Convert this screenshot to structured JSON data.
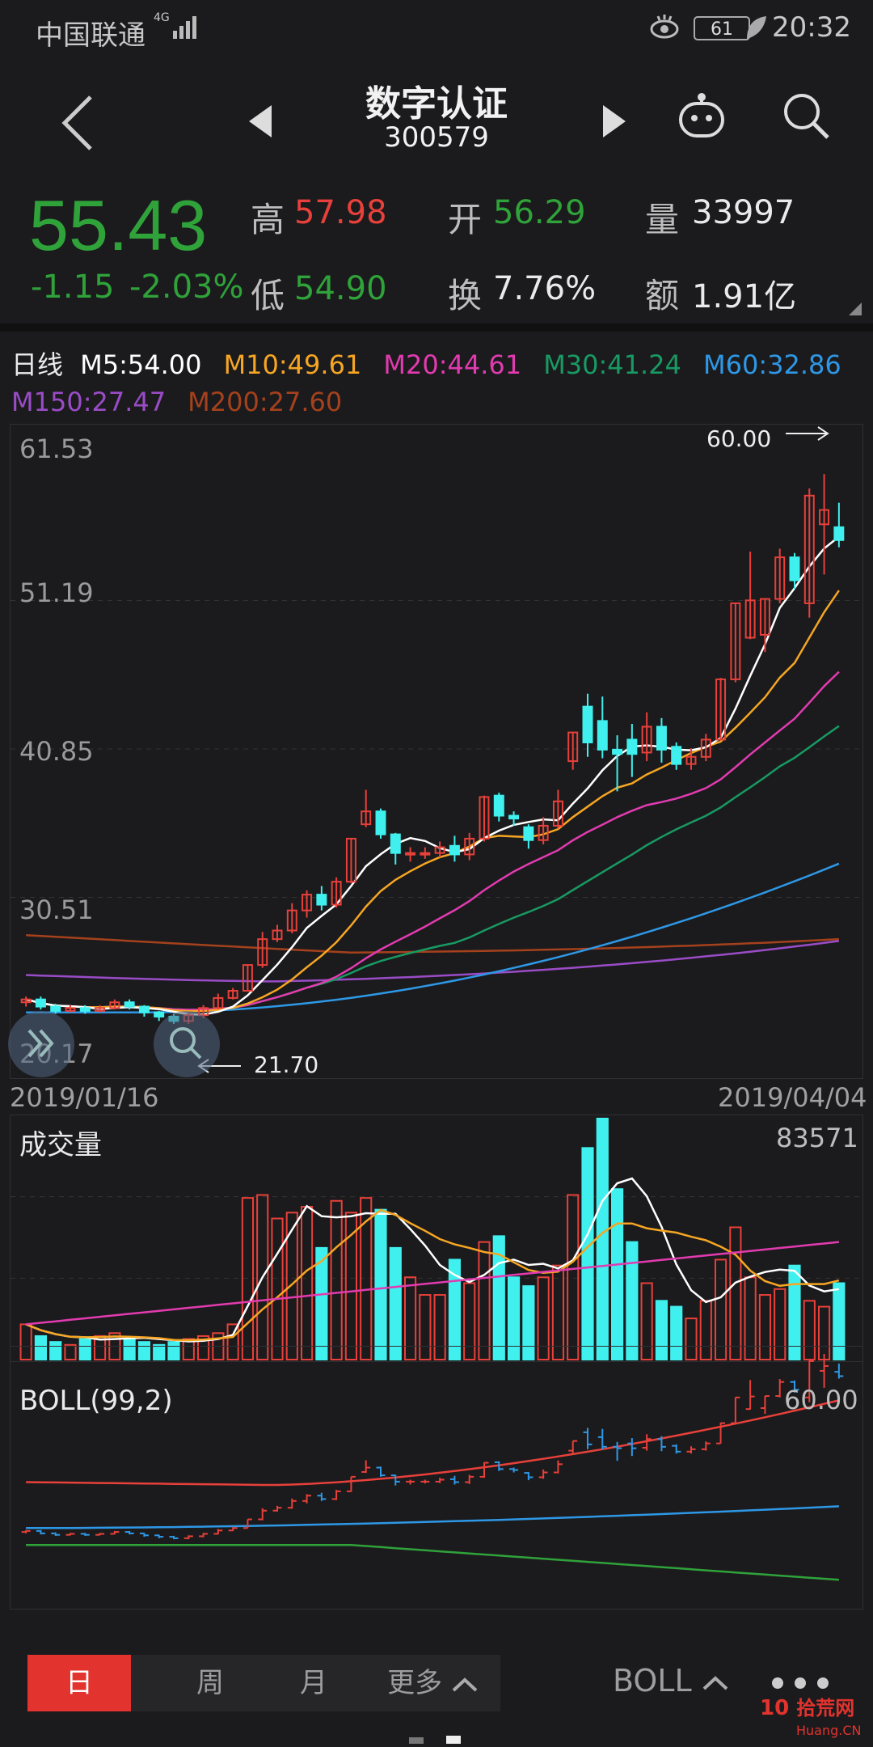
{
  "status_bar": {
    "carrier": "中国联通",
    "network": "4G",
    "battery": "61",
    "time": "20:32"
  },
  "header": {
    "name": "数字认证",
    "code": "300579"
  },
  "quote": {
    "price": "55.43",
    "change": "-1.15",
    "change_pct": "-2.03%",
    "high_label": "高",
    "high": "57.98",
    "low_label": "低",
    "low": "54.90",
    "open_label": "开",
    "open": "56.29",
    "turnover_label": "换",
    "turnover": "7.76%",
    "volume_label": "量",
    "volume": "33997",
    "amount_label": "额",
    "amount": "1.91亿"
  },
  "ma_legend": {
    "period": "日线",
    "m5": "M5:54.00",
    "m10": "M10:49.61",
    "m20": "M20:44.61",
    "m30": "M30:41.24",
    "m60": "M60:32.86",
    "m150": "M150:27.47",
    "m200": "M200:27.60"
  },
  "colors": {
    "up": "#e8403a",
    "down": "#3ff0ee",
    "m5": "#ffffff",
    "m10": "#f6a623",
    "m20": "#e23bb0",
    "m30": "#189a63",
    "m60": "#2e98e6",
    "m150": "#9a4cc7",
    "m200": "#a5411c"
  },
  "kline": {
    "y_labels": [
      "61.53",
      "51.19",
      "40.85",
      "30.51",
      "20.17"
    ],
    "high_marker": "60.00",
    "low_marker": "21.70",
    "date_start": "2019/01/16",
    "date_end": "2019/04/04",
    "ylim": [
      20.17,
      61.53
    ]
  },
  "volume_panel": {
    "title": "成交量",
    "max_label": "83571"
  },
  "boll_panel": {
    "title": "BOLL(99,2)",
    "high_marker": "60.00"
  },
  "tabs": {
    "day": "日",
    "week": "周",
    "month": "月",
    "more": "更多"
  },
  "indicator_button": "BOLL",
  "watermark": {
    "brand": "10",
    "site": "拾荒网",
    "url": "Huang.CN"
  },
  "chart_data": {
    "type": "candlestick",
    "x_range": [
      "2019/01/16",
      "2019/04/04"
    ],
    "ylim": [
      20.17,
      61.53
    ],
    "candles": [
      [
        23.2,
        23.4,
        22.9,
        23.6
      ],
      [
        23.4,
        22.9,
        22.7,
        23.6
      ],
      [
        22.9,
        22.6,
        22.4,
        23.1
      ],
      [
        22.6,
        22.8,
        22.5,
        23.0
      ],
      [
        22.8,
        22.6,
        22.4,
        23.0
      ],
      [
        22.6,
        22.8,
        22.5,
        23.0
      ],
      [
        22.8,
        23.2,
        22.7,
        23.4
      ],
      [
        23.2,
        22.9,
        22.7,
        23.4
      ],
      [
        22.9,
        22.5,
        22.2,
        23.0
      ],
      [
        22.5,
        22.2,
        21.9,
        22.6
      ],
      [
        22.2,
        21.9,
        21.7,
        22.4
      ],
      [
        21.9,
        22.3,
        21.7,
        22.5
      ],
      [
        22.3,
        22.8,
        22.1,
        23.0
      ],
      [
        22.8,
        23.5,
        22.7,
        23.8
      ],
      [
        23.5,
        24.0,
        23.4,
        24.2
      ],
      [
        24.0,
        25.8,
        24.0,
        25.8
      ],
      [
        25.8,
        27.6,
        25.6,
        28.1
      ],
      [
        27.6,
        28.2,
        27.4,
        28.6
      ],
      [
        28.2,
        29.6,
        28.0,
        30.1
      ],
      [
        29.6,
        30.7,
        29.1,
        31.0
      ],
      [
        30.7,
        30.0,
        29.6,
        31.3
      ],
      [
        30.0,
        31.6,
        29.8,
        31.9
      ],
      [
        31.6,
        34.6,
        31.5,
        34.6
      ],
      [
        35.6,
        36.5,
        35.4,
        38.0
      ],
      [
        36.5,
        34.9,
        34.6,
        36.7
      ],
      [
        34.9,
        33.6,
        32.8,
        35.0
      ],
      [
        33.6,
        33.6,
        33.0,
        34.0
      ],
      [
        33.6,
        33.6,
        33.2,
        34.0
      ],
      [
        33.6,
        34.0,
        33.3,
        34.4
      ],
      [
        34.1,
        33.5,
        33.0,
        34.8
      ],
      [
        33.5,
        34.6,
        33.1,
        35.0
      ],
      [
        34.6,
        37.5,
        34.4,
        37.6
      ],
      [
        37.6,
        36.2,
        35.8,
        37.8
      ],
      [
        36.2,
        36.0,
        35.5,
        36.5
      ],
      [
        35.4,
        34.5,
        33.9,
        35.6
      ],
      [
        34.5,
        35.5,
        34.2,
        36.1
      ],
      [
        35.5,
        37.2,
        35.3,
        38.0
      ],
      [
        40.0,
        42.0,
        39.4,
        42.0
      ],
      [
        43.8,
        41.3,
        40.3,
        44.7
      ],
      [
        42.8,
        40.8,
        40.2,
        44.5
      ],
      [
        40.8,
        40.5,
        37.9,
        41.8
      ],
      [
        41.5,
        40.5,
        38.9,
        42.6
      ],
      [
        40.6,
        42.4,
        40.0,
        43.4
      ],
      [
        42.4,
        40.8,
        39.9,
        43.0
      ],
      [
        41.0,
        39.8,
        39.4,
        41.3
      ],
      [
        39.8,
        40.3,
        39.4,
        40.9
      ],
      [
        40.3,
        41.5,
        40.0,
        41.9
      ],
      [
        41.5,
        45.7,
        41.5,
        45.8
      ],
      [
        45.7,
        51.0,
        45.5,
        51.0
      ],
      [
        48.6,
        51.2,
        48.5,
        54.6
      ],
      [
        48.8,
        51.3,
        47.6,
        51.3
      ],
      [
        51.3,
        54.2,
        51.0,
        54.8
      ],
      [
        54.2,
        52.6,
        52.0,
        54.5
      ],
      [
        51.0,
        58.5,
        50.0,
        59.0
      ],
      [
        56.5,
        57.5,
        53.0,
        60.0
      ],
      [
        56.3,
        55.4,
        54.9,
        58.0
      ]
    ],
    "ma5_end": 54.0,
    "ma10_end": 49.61,
    "ma20_end": 44.61,
    "ma30_end": 41.24,
    "ma60_end": 32.86,
    "ma150_end": 27.47,
    "ma200_end": 27.6,
    "volume_max": 83571,
    "volume": [
      12,
      8,
      6,
      5,
      7,
      8,
      9,
      7,
      6,
      5,
      6,
      7,
      8,
      9,
      12,
      55,
      56,
      48,
      50,
      52,
      38,
      54,
      50,
      55,
      51,
      38,
      28,
      22,
      22,
      34,
      26,
      40,
      42,
      28,
      25,
      28,
      32,
      56,
      72,
      82,
      58,
      40,
      26,
      20,
      18,
      14,
      20,
      34,
      45,
      28,
      22,
      24,
      32,
      20,
      18,
      26
    ]
  }
}
